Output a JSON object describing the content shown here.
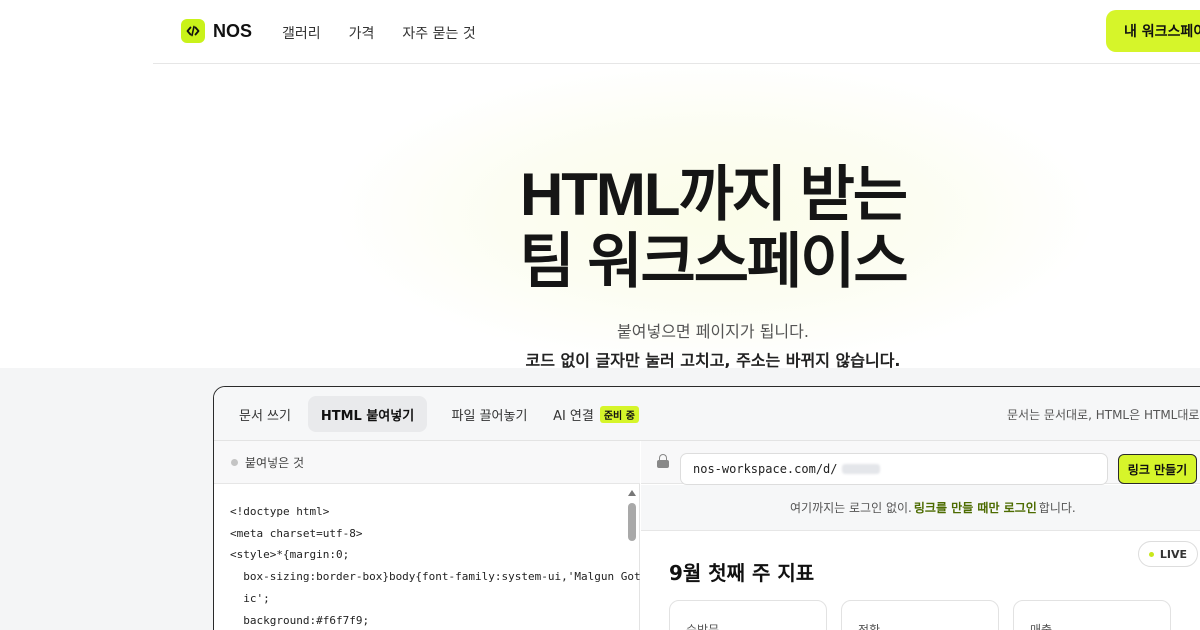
{
  "header": {
    "logo_text": "NOS",
    "logo_icon": "code-icon",
    "nav": [
      "갤러리",
      "가격",
      "자주 묻는 것"
    ],
    "cta_label": "내 워크스페이스"
  },
  "hero": {
    "title_line1": "HTML까지 받는",
    "title_line2": "팀 워크스페이스",
    "subtitle1": "붙여넣으면 페이지가 됩니다.",
    "subtitle2": "코드 없이 글자만 눌러 고치고, 주소는 바뀌지 않습니다."
  },
  "editor": {
    "tabs": [
      {
        "label": "문서 쓰기",
        "active": false
      },
      {
        "label": "HTML 붙여넣기",
        "active": true
      },
      {
        "label": "파일 끌어놓기",
        "active": false
      },
      {
        "label": "AI 연결",
        "active": false,
        "badge": "준비 중"
      }
    ],
    "tabs_note": "문서는 문서대로, HTML은 HTML대로",
    "left_pane": {
      "title": "붙여넣은 것",
      "code_lines": [
        "<!doctype html>",
        "<meta charset=utf-8>",
        "<style>*{margin:0;",
        "  box-sizing:border-box}body{font-family:system-ui,'Malgun Goth",
        "  ic';",
        "  background:#f6f7f9;"
      ]
    },
    "right_pane": {
      "url_text": "nos-workspace.com/d/",
      "make_link_label": "링크 만들기",
      "note_before": "여기까지는 로그인 없이.",
      "note_highlight": "링크를 만들 때만 로그인",
      "note_after": "합니다.",
      "live_label": "LIVE",
      "metrics_title": "9월 첫째 주 지표",
      "cards": [
        "순방문",
        "전환",
        "매출"
      ]
    }
  },
  "colors": {
    "accent": "#d6f52a",
    "text": "#151515",
    "band": "#f4f5f6"
  }
}
